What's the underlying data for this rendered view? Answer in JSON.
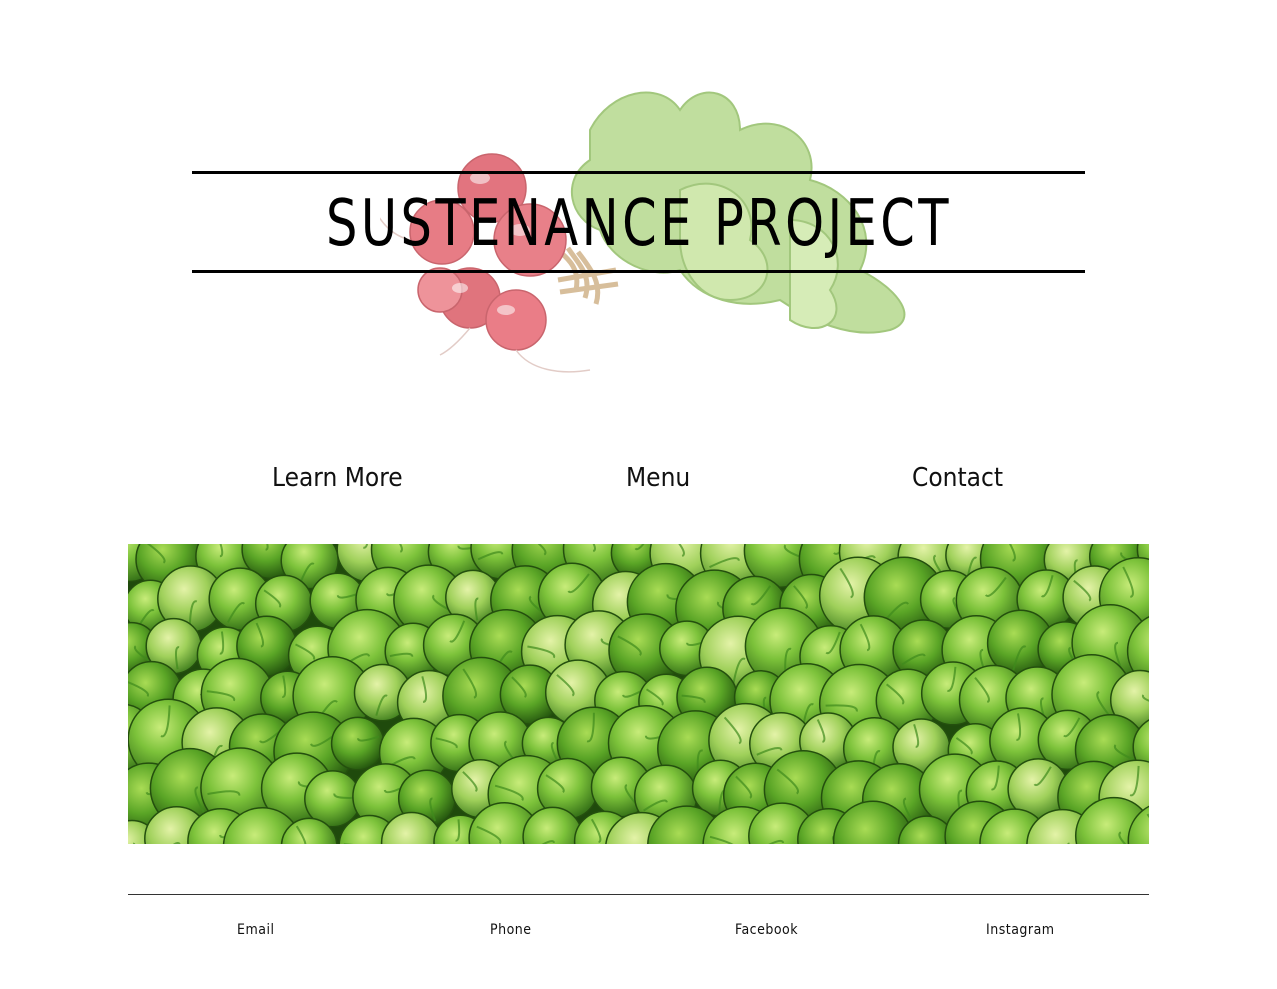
{
  "header": {
    "title": "SUSTENANCE PROJECT",
    "hero_image": "radishes-illustration"
  },
  "nav": {
    "items": [
      {
        "label": "Learn More"
      },
      {
        "label": "Menu"
      },
      {
        "label": "Contact"
      }
    ]
  },
  "banner": {
    "image": "brussels-sprouts-photo"
  },
  "footer": {
    "links": [
      {
        "label": "Email"
      },
      {
        "label": "Phone"
      },
      {
        "label": "Facebook"
      },
      {
        "label": "Instagram"
      }
    ]
  },
  "colors": {
    "text": "#111111",
    "background": "#ffffff",
    "sprout_dark": "#2f6a14",
    "sprout_light": "#9fd05a",
    "radish_red": "#d8404e",
    "leaf_green": "#9ccc6a"
  }
}
